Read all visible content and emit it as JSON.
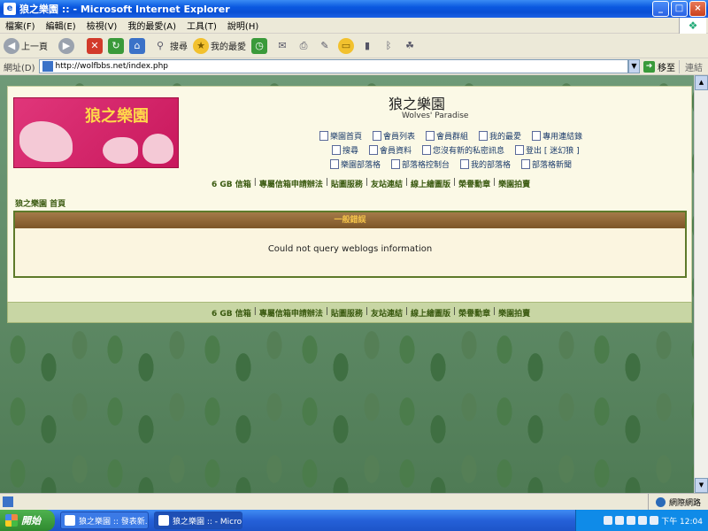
{
  "window": {
    "title": "狼之樂園 :: - Microsoft Internet Explorer",
    "app_icon": "e",
    "buttons": [
      "_",
      "□",
      "×"
    ]
  },
  "menu": [
    "檔案(F)",
    "編輯(E)",
    "檢視(V)",
    "我的最愛(A)",
    "工具(T)",
    "說明(H)"
  ],
  "toolbar": {
    "back_label": "上一頁",
    "search_label": "搜尋",
    "favorites_label": "我的最愛"
  },
  "address": {
    "label": "網址(D)",
    "url": "http://wolfbbs.net/index.php",
    "go_label": "移至",
    "links_label": "連結"
  },
  "site": {
    "logo_text": "狼之樂園",
    "title": "狼之樂園",
    "subtitle": "Wolves' Paradise"
  },
  "nav": {
    "row1": [
      "樂園首頁",
      "會員列表",
      "會員群組",
      "我的最愛",
      "專用連結錄"
    ],
    "row2": [
      "搜尋",
      "會員資料",
      "您沒有新的私密訊息",
      "登出 [ 迷幻狼 ]"
    ],
    "row3": [
      "樂園部落格",
      "部落格控制台",
      "我的部落格",
      "部落格新聞"
    ]
  },
  "links": [
    "6 GB 信箱",
    "專屬信箱申請辦法",
    "貼圖服務",
    "友站連結",
    "線上繪圖版",
    "榮譽勳章",
    "樂園拍賣"
  ],
  "breadcrumb": "狼之樂園 首頁",
  "error": {
    "header": "一般錯誤",
    "message": "Could not query weblogs information"
  },
  "status": {
    "zone": "網際網路"
  },
  "taskbar": {
    "start": "開始",
    "tasks": [
      "狼之樂園 :: 發表新...",
      "狼之樂園 :: - Micros..."
    ],
    "clock": "下午 12:04"
  }
}
